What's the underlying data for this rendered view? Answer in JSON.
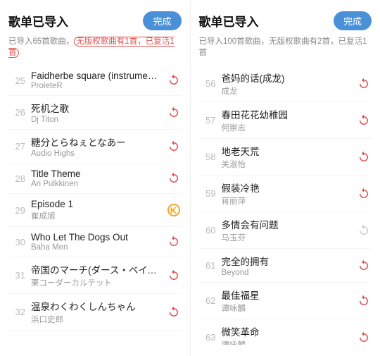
{
  "left_panel": {
    "title": "歌单已导入",
    "btn_label": "完成",
    "status": "已导入65首歌曲，",
    "status_highlight": "无版权歌曲有1首，已复活1首",
    "songs": [
      {
        "index": 25,
        "name": "Faidherbe square (instrumental)",
        "artist": "ProleteR",
        "icon": "sync-red"
      },
      {
        "index": 26,
        "name": "死机之歌",
        "artist": "Dj Titon",
        "icon": "sync-red"
      },
      {
        "index": 27,
        "name": "糖分とらねぇとなあー",
        "artist": "Audio Highs",
        "icon": "sync-red"
      },
      {
        "index": 28,
        "name": "Title Theme",
        "artist": "Ari Pulkkinen",
        "icon": "sync-red"
      },
      {
        "index": 29,
        "name": "Episode 1",
        "artist": "崔成旭",
        "icon": "sync-orange"
      },
      {
        "index": 30,
        "name": "Who Let The Dogs Out",
        "artist": "Baha Men",
        "icon": "sync-red"
      },
      {
        "index": 31,
        "name": "帝国のマーチ(ダース・ベイダーのテー...",
        "artist": "栗コーダーカルテット",
        "icon": "sync-red"
      },
      {
        "index": 32,
        "name": "温泉わくわくしんちゃん",
        "artist": "浜口史郎",
        "icon": "sync-red"
      }
    ]
  },
  "right_panel": {
    "title": "歌单已导入",
    "btn_label": "完成",
    "status": "已导入100首歌曲，无版权歌曲有2首，已复活1首",
    "songs": [
      {
        "index": 56,
        "name": "爸妈的话(成龙)",
        "artist": "成龙",
        "icon": "sync-red"
      },
      {
        "index": 57,
        "name": "春田花花幼稚园",
        "artist": "何崇志",
        "icon": "sync-red"
      },
      {
        "index": 58,
        "name": "地老天荒",
        "artist": "关淑怡",
        "icon": "sync-red"
      },
      {
        "index": 59,
        "name": "假装冷艳",
        "artist": "蒋丽萍",
        "icon": "sync-red"
      },
      {
        "index": 60,
        "name": "多情会有问题",
        "artist": "马玉芬",
        "icon": "sync-gray"
      },
      {
        "index": 61,
        "name": "完全的拥有",
        "artist": "Beyond",
        "icon": "sync-red"
      },
      {
        "index": 62,
        "name": "最佳福星",
        "artist": "谭咏麟",
        "icon": "sync-red"
      },
      {
        "index": 63,
        "name": "微笑革命",
        "artist": "谭咏麟",
        "icon": "sync-red"
      }
    ]
  }
}
